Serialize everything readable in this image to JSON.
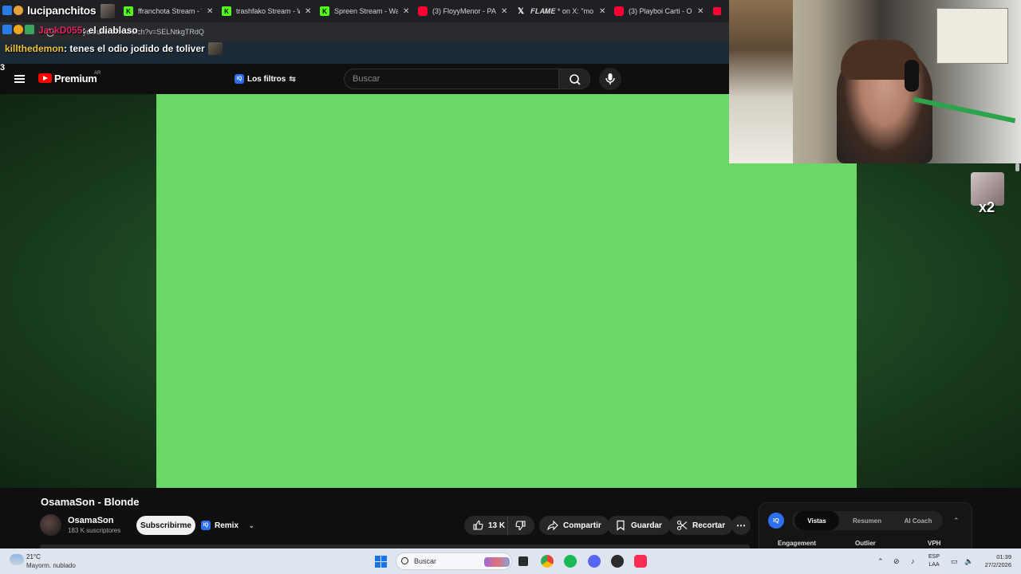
{
  "browser": {
    "tabs": [
      {
        "title": "ffranchota Stream - W",
        "favicon": "kick-icon",
        "color": "#53fc18"
      },
      {
        "title": "trashfako Stream - W",
        "favicon": "kick-icon",
        "color": "#53fc18"
      },
      {
        "title": "Spreen Stream - Wat",
        "favicon": "kick-icon",
        "color": "#53fc18"
      },
      {
        "title": "(3) FloyyMenor - PA",
        "favicon": "youtube-icon",
        "color": "#ff0033"
      },
      {
        "title": "𝑭𝑳𝑨𝑴𝑬 * on X: \"mo",
        "favicon": "x-icon",
        "color": "#ffffff"
      },
      {
        "title": "(3) Playboi Carti - OP",
        "favicon": "youtube-icon",
        "color": "#ff0033"
      }
    ],
    "url": "youtube.com/watch?v=SELNtkgTRdQ"
  },
  "stream_overlay": {
    "streamer": "lucipanchitos",
    "counter": "3",
    "chat": [
      {
        "user": "JackD055",
        "text": ": el diablaso"
      },
      {
        "user": "killthedemon",
        "text": ": tenes el odio jodido de toliver"
      }
    ]
  },
  "youtube": {
    "brand": "Premium",
    "region": "AR",
    "filters_label": "Los filtros",
    "search_placeholder": "Buscar",
    "video": {
      "title": "OsamaSon - Blonde",
      "channel": "OsamaSon",
      "subscribers": "183 K suscriptores",
      "subscribe_label": "Subscribirme",
      "remix_label": "Remix",
      "likes": "13 K",
      "share_label": "Compartir",
      "save_label": "Guardar",
      "clip_label": "Recortar"
    },
    "overlay_multiplier": "x2"
  },
  "side_panel": {
    "badge": "IQ",
    "tabs": [
      "Vistas",
      "Resumen",
      "AI Coach"
    ],
    "active_tab": "Vistas",
    "columns": [
      "Engagement",
      "Outlier",
      "VPH"
    ]
  },
  "taskbar": {
    "temperature": "21°C",
    "weather": "Mayorm. nublado",
    "search_placeholder": "Buscar",
    "language": "ESP",
    "layout": "LAA",
    "time": "01:39",
    "date": "27/2/2026"
  },
  "colors": {
    "video_green": "#69d866",
    "youtube_red": "#ff0000",
    "accent_blue": "#2e6ff2"
  }
}
